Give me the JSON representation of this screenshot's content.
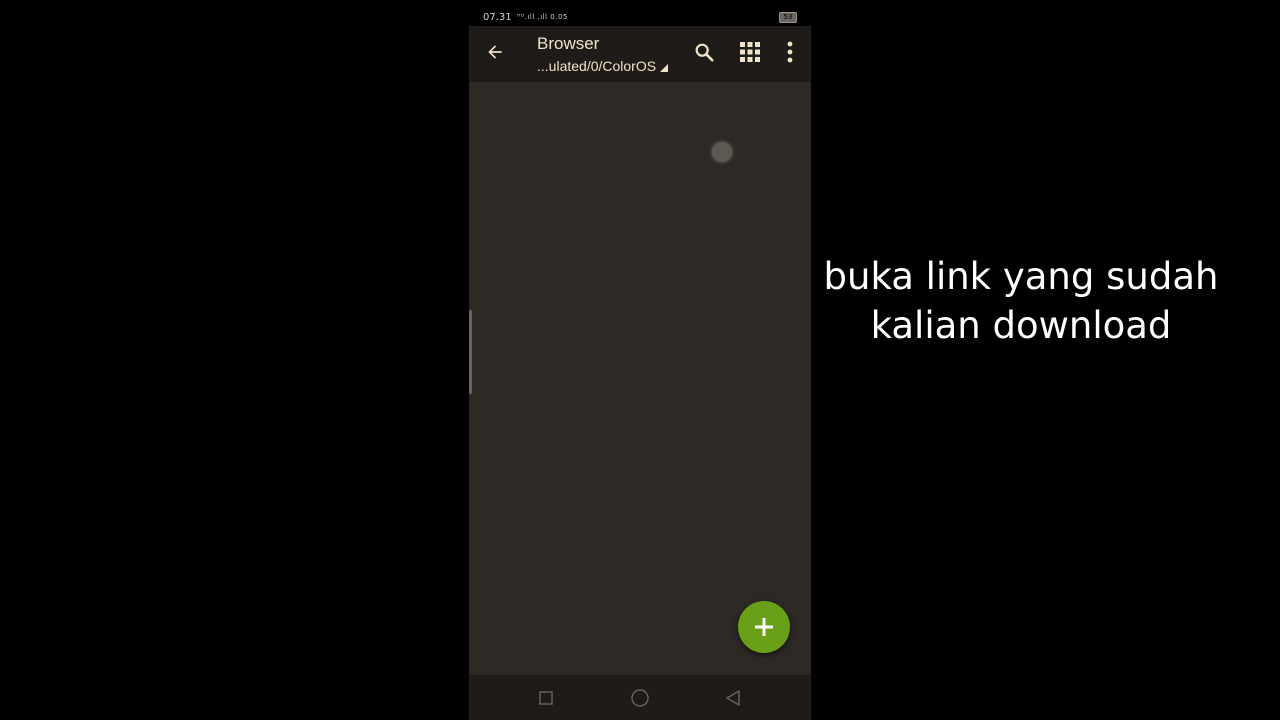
{
  "status_bar": {
    "time": "07.31",
    "indicators": "ᴴᴰ.ıll .ıll 0.05",
    "battery_level": "53"
  },
  "app_bar": {
    "title": "Browser",
    "path": "...ulated/0/ColorOS",
    "icons": {
      "back": "arrow-left-icon",
      "search": "search-icon",
      "grid": "grid-view-icon",
      "more": "more-vertical-icon"
    }
  },
  "fab": {
    "icon": "plus-icon",
    "color": "#6aa017"
  },
  "nav_bar": {
    "icons": [
      "square-recents-icon",
      "circle-home-icon",
      "triangle-back-icon"
    ]
  },
  "caption": {
    "line1": "buka link yang sudah",
    "line2": "kalian download"
  },
  "colors": {
    "app_bar": "#1e1b18",
    "content": "#2d2925",
    "accent_text": "#f1e3c6"
  }
}
